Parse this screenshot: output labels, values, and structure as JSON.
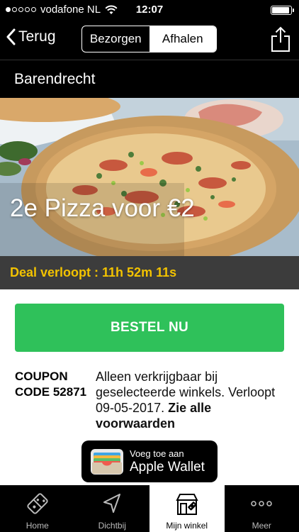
{
  "status_bar": {
    "carrier": "vodafone NL",
    "time": "12:07",
    "signal_bars_filled": 1,
    "signal_bars_total": 5,
    "battery_level": 0.9
  },
  "nav": {
    "back_label": "Terug",
    "segments": [
      "Bezorgen",
      "Afhalen"
    ],
    "active_segment": "Afhalen",
    "share_icon": "share-icon"
  },
  "store": {
    "name": "Barendrecht"
  },
  "deal": {
    "title": "2e Pizza voor €2",
    "countdown": "Deal verloopt : 11h 52m 11s"
  },
  "order_button": {
    "label": "BESTEL NU"
  },
  "coupon": {
    "label_line1": "COUPON",
    "label_line2": "CODE 52871",
    "description": "Alleen verkrijgbaar bij geselecteerde winkels. Verloopt 09-05-2017.",
    "terms_link": "Zie alle voorwaarden"
  },
  "wallet": {
    "line1": "Voeg toe aan",
    "line2": "Apple Wallet"
  },
  "tabs": [
    {
      "label": "Home",
      "icon": "domino-icon"
    },
    {
      "label": "Dichtbij",
      "icon": "location-arrow-icon"
    },
    {
      "label": "Mijn winkel",
      "icon": "store-icon"
    },
    {
      "label": "Meer",
      "icon": "more-dots-icon"
    }
  ],
  "active_tab": "Mijn winkel",
  "colors": {
    "accent_green": "#2fc15a",
    "countdown_yellow": "#f2c200",
    "bar_black": "#000000",
    "deal_bar_gray": "#3c3c3c"
  }
}
